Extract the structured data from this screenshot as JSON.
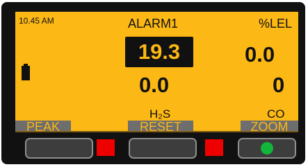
{
  "status": {
    "time": "10.45 AM"
  },
  "alarm": {
    "label": "ALARM1",
    "value": "19.3"
  },
  "lel": {
    "unit": "%LEL",
    "value": "0.0"
  },
  "h2s": {
    "value": "0.0",
    "label": "H₂S"
  },
  "co": {
    "value": "0",
    "label": "CO"
  },
  "softkeys": {
    "left": "PEAK",
    "center": "RESET",
    "right": "ZOOM"
  },
  "icons": {
    "battery": "battery-icon",
    "status_led": "green-status-led"
  },
  "colors": {
    "screen": "#fcb814",
    "softkey_bar": "#6e6e6e",
    "alarm_led": "#ee0000",
    "ok_led": "#11b53a"
  }
}
